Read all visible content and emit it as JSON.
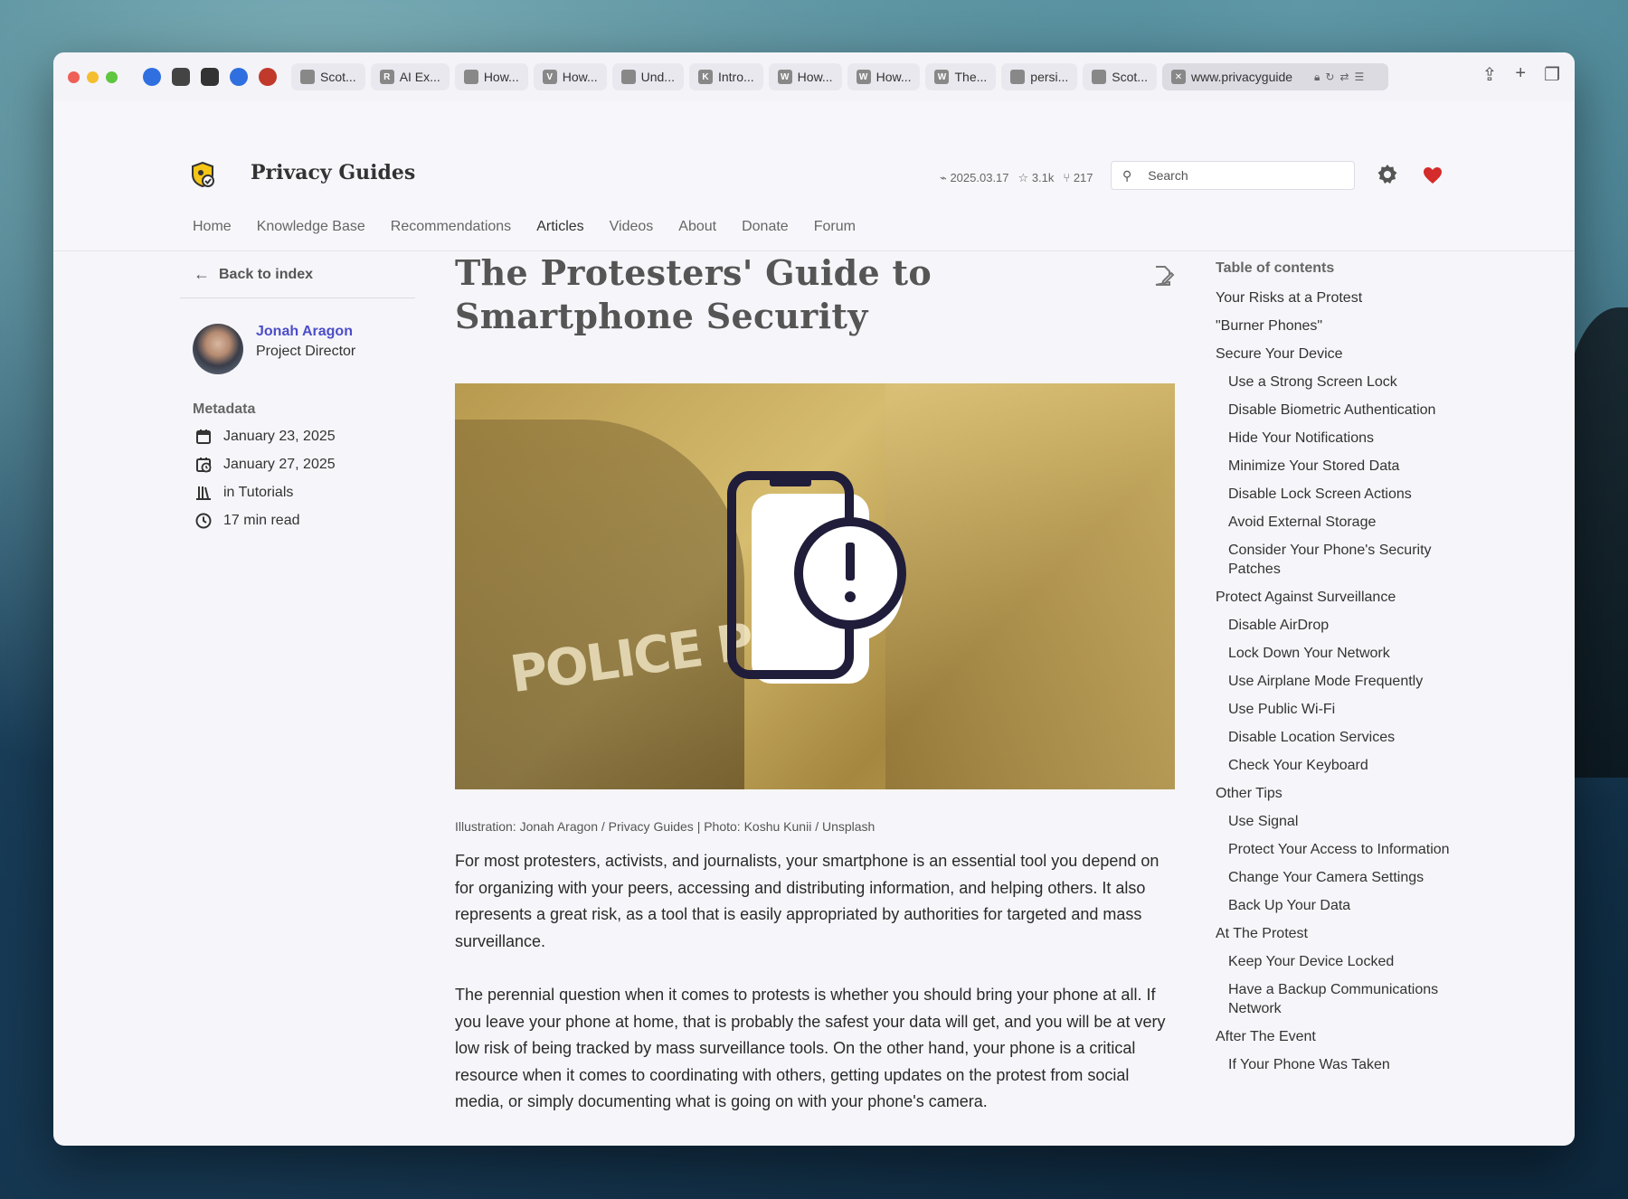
{
  "browser": {
    "pinned_tabs": [
      {
        "icon": "refresh-app-icon",
        "color": "#2f6fe0"
      },
      {
        "icon": "shield-app-icon",
        "color": "#444444"
      },
      {
        "icon": "notion-icon",
        "color": "#333333"
      },
      {
        "icon": "fingerprint-icon",
        "color": "#2f6fe0"
      },
      {
        "icon": "record-icon",
        "color": "#c0392b"
      }
    ],
    "tabs": [
      {
        "label": "Scot...",
        "icon_letter": ""
      },
      {
        "label": "AI Ex...",
        "icon_letter": "R"
      },
      {
        "label": "How...",
        "icon_letter": ""
      },
      {
        "label": "How...",
        "icon_letter": "V"
      },
      {
        "label": "Und...",
        "icon_letter": ""
      },
      {
        "label": "Intro...",
        "icon_letter": "K"
      },
      {
        "label": "How...",
        "icon_letter": "W"
      },
      {
        "label": "How...",
        "icon_letter": "W"
      },
      {
        "label": "The...",
        "icon_letter": "W"
      },
      {
        "label": "persi...",
        "icon_letter": ""
      },
      {
        "label": "Scot...",
        "icon_letter": ""
      }
    ],
    "active_tab": {
      "url": "www.privacyguide"
    }
  },
  "site": {
    "title": "Privacy Guides",
    "version": "2025.03.17",
    "stars": "3.1k",
    "forks": "217",
    "search_placeholder": "Search",
    "accent": "#d42b2b",
    "nav": [
      "Home",
      "Knowledge Base",
      "Recommendations",
      "Articles",
      "Videos",
      "About",
      "Donate",
      "Forum"
    ],
    "nav_current": "Articles"
  },
  "left": {
    "back_label": "Back to index",
    "author_name": "Jonah Aragon",
    "author_role": "Project Director",
    "metadata_title": "Metadata",
    "published": "January 23, 2025",
    "updated": "January 27, 2025",
    "category": "in Tutorials",
    "read_time": "17 min read"
  },
  "article": {
    "title": "The Protesters' Guide to Smartphone Security",
    "hero_text": "POLICE POLI",
    "caption": "Illustration: Jonah Aragon / Privacy Guides | Photo: Koshu Kunii / Unsplash",
    "paragraphs": [
      "For most protesters, activists, and journalists, your smartphone is an essential tool you depend on for organizing with your peers, accessing and distributing information, and helping others. It also represents a great risk, as a tool that is easily appropriated by authorities for targeted and mass surveillance.",
      "The perennial question when it comes to protests is whether you should bring your phone at all. If you leave your phone at home, that is probably the safest your data will get, and you will be at very low risk of being tracked by mass surveillance tools. On the other hand, your phone is a critical resource when it comes to coordinating with others, getting updates on the protest from social media, or simply documenting what is going on with your phone's camera."
    ]
  },
  "toc": {
    "title": "Table of contents",
    "items": [
      {
        "label": "Your Risks at a Protest",
        "level": 1
      },
      {
        "label": "\"Burner Phones\"",
        "level": 1
      },
      {
        "label": "Secure Your Device",
        "level": 1
      },
      {
        "label": "Use a Strong Screen Lock",
        "level": 2
      },
      {
        "label": "Disable Biometric Authentication",
        "level": 2
      },
      {
        "label": "Hide Your Notifications",
        "level": 2
      },
      {
        "label": "Minimize Your Stored Data",
        "level": 2
      },
      {
        "label": "Disable Lock Screen Actions",
        "level": 2
      },
      {
        "label": "Avoid External Storage",
        "level": 2
      },
      {
        "label": "Consider Your Phone's Security Patches",
        "level": 2
      },
      {
        "label": "Protect Against Surveillance",
        "level": 1
      },
      {
        "label": "Disable AirDrop",
        "level": 2
      },
      {
        "label": "Lock Down Your Network",
        "level": 2
      },
      {
        "label": "Use Airplane Mode Frequently",
        "level": 2
      },
      {
        "label": "Use Public Wi-Fi",
        "level": 2
      },
      {
        "label": "Disable Location Services",
        "level": 2
      },
      {
        "label": "Check Your Keyboard",
        "level": 2
      },
      {
        "label": "Other Tips",
        "level": 1
      },
      {
        "label": "Use Signal",
        "level": 2
      },
      {
        "label": "Protect Your Access to Information",
        "level": 2
      },
      {
        "label": "Change Your Camera Settings",
        "level": 2
      },
      {
        "label": "Back Up Your Data",
        "level": 2
      },
      {
        "label": "At The Protest",
        "level": 1
      },
      {
        "label": "Keep Your Device Locked",
        "level": 2
      },
      {
        "label": "Have a Backup Communications Network",
        "level": 2
      },
      {
        "label": "After The Event",
        "level": 1
      },
      {
        "label": "If Your Phone Was Taken",
        "level": 2
      }
    ]
  }
}
